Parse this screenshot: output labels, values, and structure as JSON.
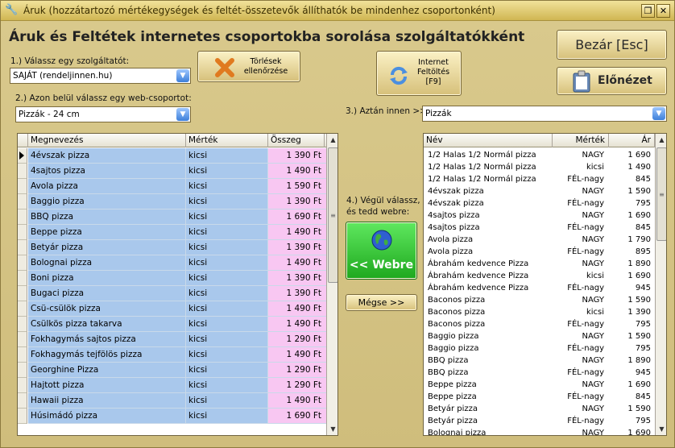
{
  "window": {
    "title": "Áruk (hozzátartozó mértékegységek és feltét-összetevők állíthatók be mindenhez csoportonként)"
  },
  "heading": "Áruk és Feltétek internetes csoportokba sorolása szolgáltatókként",
  "step1": {
    "label": "1.) Válassz egy szolgáltatót:",
    "value": "SAJÁT (rendeljinnen.hu)"
  },
  "step2": {
    "label": "2.) Azon belül válassz egy web-csoportot:",
    "value": "Pizzák - 24 cm"
  },
  "step3": {
    "label": "3.) Aztán innen >>",
    "value": "Pizzák"
  },
  "step4": {
    "label_line1": "4.) Végül válassz,",
    "label_line2": "és tedd webre:"
  },
  "buttons": {
    "torlesek_line1": "Törlések",
    "torlesek_line2": "ellenőrzése",
    "internet_line1": "Internet",
    "internet_line2": "Feltöltés",
    "internet_line3": "[F9]",
    "bezar": "Bezár [Esc]",
    "elonezet": "Előnézet",
    "webre": "<< Webre",
    "megse": "Mégse >>"
  },
  "left_grid": {
    "headers": [
      "Megnevezés",
      "Mérték",
      "Összeg"
    ],
    "rows": [
      [
        "4évszak pizza",
        "kicsi",
        "1 390 Ft"
      ],
      [
        "4sajtos pizza",
        "kicsi",
        "1 490 Ft"
      ],
      [
        "Avola pizza",
        "kicsi",
        "1 590 Ft"
      ],
      [
        "Baggio pizza",
        "kicsi",
        "1 390 Ft"
      ],
      [
        "BBQ pizza",
        "kicsi",
        "1 690 Ft"
      ],
      [
        "Beppe pizza",
        "kicsi",
        "1 490 Ft"
      ],
      [
        "Betyár pizza",
        "kicsi",
        "1 390 Ft"
      ],
      [
        "Bolognai pizza",
        "kicsi",
        "1 490 Ft"
      ],
      [
        "Boni pizza",
        "kicsi",
        "1 390 Ft"
      ],
      [
        "Bugaci pizza",
        "kicsi",
        "1 390 Ft"
      ],
      [
        "Csü-csülök pizza",
        "kicsi",
        "1 490 Ft"
      ],
      [
        "Csülkös pizza takarva",
        "kicsi",
        "1 490 Ft"
      ],
      [
        "Fokhagymás sajtos pizza",
        "kicsi",
        "1 290 Ft"
      ],
      [
        "Fokhagymás tejfölös pizza",
        "kicsi",
        "1 490 Ft"
      ],
      [
        "Georghine Pizza",
        "kicsi",
        "1 290 Ft"
      ],
      [
        "Hajtott pizza",
        "kicsi",
        "1 290 Ft"
      ],
      [
        "Hawaii pizza",
        "kicsi",
        "1 490 Ft"
      ],
      [
        "Húsimádó  pizza",
        "kicsi",
        "1 690 Ft"
      ]
    ]
  },
  "right_grid": {
    "headers": [
      "Név",
      "Mérték",
      "Ár"
    ],
    "rows": [
      [
        "1/2 Halas 1/2 Normál pizza",
        "NAGY",
        "1 690"
      ],
      [
        "1/2 Halas 1/2 Normál pizza",
        "kicsi",
        "1 490"
      ],
      [
        "1/2 Halas 1/2 Normál pizza",
        "FÉL-nagy",
        "845"
      ],
      [
        "4évszak pizza",
        "NAGY",
        "1 590"
      ],
      [
        "4évszak pizza",
        "FÉL-nagy",
        "795"
      ],
      [
        "4sajtos pizza",
        "NAGY",
        "1 690"
      ],
      [
        "4sajtos pizza",
        "FÉL-nagy",
        "845"
      ],
      [
        "Avola pizza",
        "NAGY",
        "1 790"
      ],
      [
        "Avola pizza",
        "FÉL-nagy",
        "895"
      ],
      [
        "Ábrahám kedvence Pizza",
        "NAGY",
        "1 890"
      ],
      [
        "Ábrahám kedvence Pizza",
        "kicsi",
        "1 690"
      ],
      [
        "Ábrahám kedvence Pizza",
        "FÉL-nagy",
        "945"
      ],
      [
        "Baconos pizza",
        "NAGY",
        "1 590"
      ],
      [
        "Baconos pizza",
        "kicsi",
        "1 390"
      ],
      [
        "Baconos pizza",
        "FÉL-nagy",
        "795"
      ],
      [
        "Baggio pizza",
        "NAGY",
        "1 590"
      ],
      [
        "Baggio pizza",
        "FÉL-nagy",
        "795"
      ],
      [
        "BBQ pizza",
        "NAGY",
        "1 890"
      ],
      [
        "BBQ pizza",
        "FÉL-nagy",
        "945"
      ],
      [
        "Beppe pizza",
        "NAGY",
        "1 690"
      ],
      [
        "Beppe pizza",
        "FÉL-nagy",
        "845"
      ],
      [
        "Betyár pizza",
        "NAGY",
        "1 590"
      ],
      [
        "Betyár pizza",
        "FÉL-nagy",
        "795"
      ],
      [
        "Bolognai pizza",
        "NAGY",
        "1 690"
      ]
    ]
  },
  "colors": {
    "left_name_bg": "#a9c8ec",
    "left_price_bg": "#f8c7f2",
    "webre_bg": "#24c424",
    "accent_orange": "#e07a1f"
  }
}
